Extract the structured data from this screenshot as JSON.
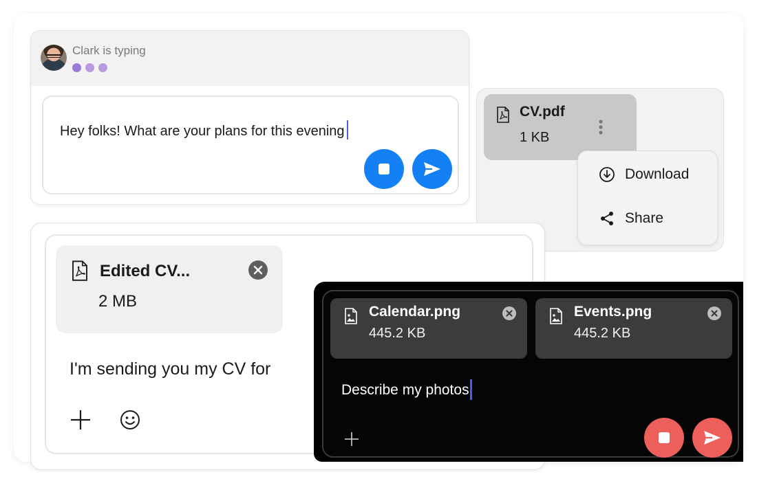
{
  "typing_card": {
    "typing_text": "Clark is typing",
    "message_text": "Hey folks! What are your plans for this evening"
  },
  "file_menu_card": {
    "file_name": "CV.pdf",
    "file_size": "1 KB",
    "menu_items": [
      {
        "label": "Download",
        "icon": "download-icon"
      },
      {
        "label": "Share",
        "icon": "share-icon"
      }
    ]
  },
  "cv_card": {
    "file_name": "Edited CV...",
    "file_size": "2 MB",
    "message_text": "I'm sending you my CV for"
  },
  "dark_card": {
    "attachments": [
      {
        "name": "Calendar.png",
        "size": "445.2 KB"
      },
      {
        "name": "Events.png",
        "size": "445.2 KB"
      }
    ],
    "message_text": "Describe my photos"
  },
  "colors": {
    "send_blue": "#1380f5",
    "send_red": "#ec5f5a",
    "typing_dots": "#b79ae0",
    "caret": "#4a60e8"
  }
}
